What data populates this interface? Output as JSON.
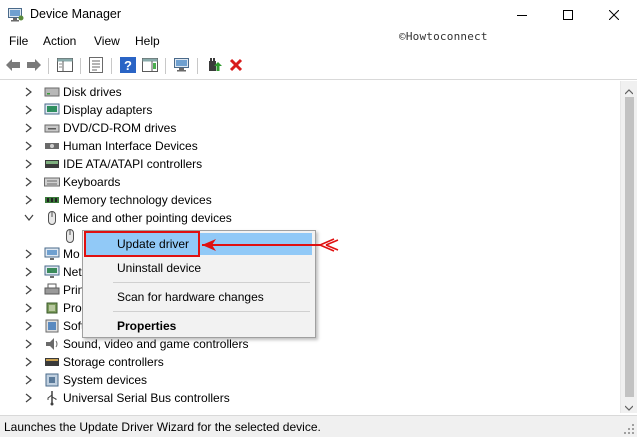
{
  "window": {
    "title": "Device Manager",
    "icons": {
      "app": "device-manager-icon",
      "minimize": "minimize-icon",
      "maximize": "maximize-icon",
      "close": "close-icon"
    }
  },
  "watermark": "©Howtoconnect",
  "menu": [
    "File",
    "Action",
    "View",
    "Help"
  ],
  "toolbar": {
    "icons": [
      "back-arrow-icon",
      "forward-arrow-icon",
      "show-hide-tree-icon",
      "properties-icon",
      "help-icon",
      "action-pane-icon",
      "scan-hardware-icon",
      "update-driver-icon",
      "uninstall-device-icon"
    ]
  },
  "tree": {
    "items": [
      {
        "label": "Disk drives",
        "expanded": false,
        "icon": "disk-drive-icon"
      },
      {
        "label": "Display adapters",
        "expanded": false,
        "icon": "display-adapter-icon"
      },
      {
        "label": "DVD/CD-ROM drives",
        "expanded": false,
        "icon": "dvd-drive-icon"
      },
      {
        "label": "Human Interface Devices",
        "expanded": false,
        "icon": "hid-icon"
      },
      {
        "label": "IDE ATA/ATAPI controllers",
        "expanded": false,
        "icon": "ide-controller-icon"
      },
      {
        "label": "Keyboards",
        "expanded": false,
        "icon": "keyboard-icon"
      },
      {
        "label": "Memory technology devices",
        "expanded": false,
        "icon": "memory-device-icon"
      },
      {
        "label": "Mice and other pointing devices",
        "expanded": true,
        "icon": "mouse-icon"
      },
      {
        "label": "",
        "child": true,
        "icon": "mouse-icon"
      },
      {
        "label": "Mo",
        "expanded": false,
        "icon": "monitor-icon"
      },
      {
        "label": "Net",
        "expanded": false,
        "icon": "network-adapter-icon"
      },
      {
        "label": "Prin",
        "expanded": false,
        "icon": "print-queue-icon"
      },
      {
        "label": "Pro",
        "expanded": false,
        "icon": "processor-icon"
      },
      {
        "label": "Soft",
        "expanded": false,
        "icon": "software-device-icon"
      },
      {
        "label": "Sound, video and game controllers",
        "expanded": false,
        "icon": "sound-icon"
      },
      {
        "label": "Storage controllers",
        "expanded": false,
        "icon": "storage-controller-icon"
      },
      {
        "label": "System devices",
        "expanded": false,
        "icon": "system-device-icon"
      },
      {
        "label": "Universal Serial Bus controllers",
        "expanded": false,
        "icon": "usb-icon"
      }
    ]
  },
  "context_menu": {
    "items": [
      {
        "label": "Update driver",
        "highlighted": true,
        "bold": false
      },
      {
        "label": "Uninstall device",
        "highlighted": false,
        "bold": false
      },
      {
        "label": "Scan for hardware changes",
        "highlighted": false,
        "bold": false
      },
      {
        "label": "Properties",
        "highlighted": false,
        "bold": true
      }
    ]
  },
  "status": "Launches the Update Driver Wizard for the selected device.",
  "colors": {
    "menu_highlight": "#91c9f7",
    "annotation_red": "#e01010",
    "uninstall_red": "#d81b1b",
    "help_blue": "#2a64c5"
  }
}
